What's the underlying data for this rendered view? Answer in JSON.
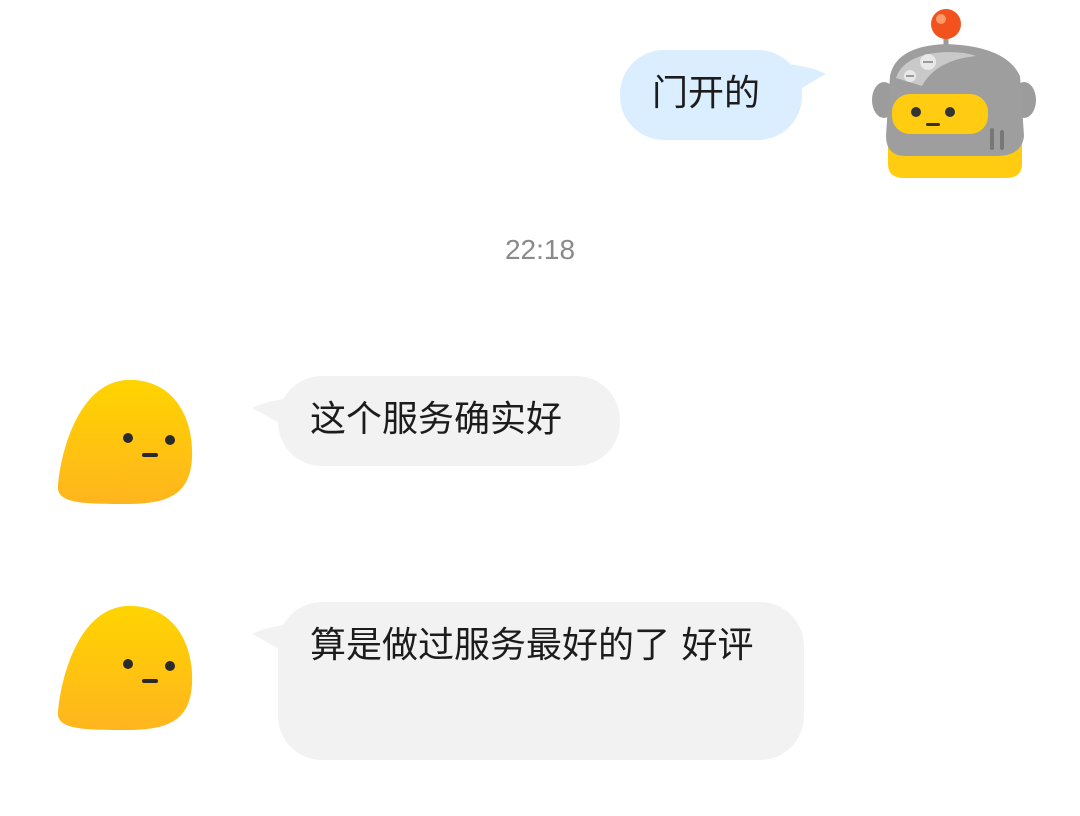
{
  "messages": [
    {
      "sender": "self",
      "text": "门开的"
    },
    {
      "sender": "other",
      "text": "这个服务确实好"
    },
    {
      "sender": "other",
      "text": "算是做过服务最好的了 好评"
    }
  ],
  "timestamp": "22:18",
  "colors": {
    "outgoing_bubble": "#dbeeff",
    "incoming_bubble": "#f2f2f2",
    "avatar_yellow": "#ffcc00",
    "timestamp_text": "#8a8a8a"
  },
  "icons": {
    "self_avatar": "robot-avatar-icon",
    "other_avatar": "yellow-blob-avatar-icon"
  }
}
